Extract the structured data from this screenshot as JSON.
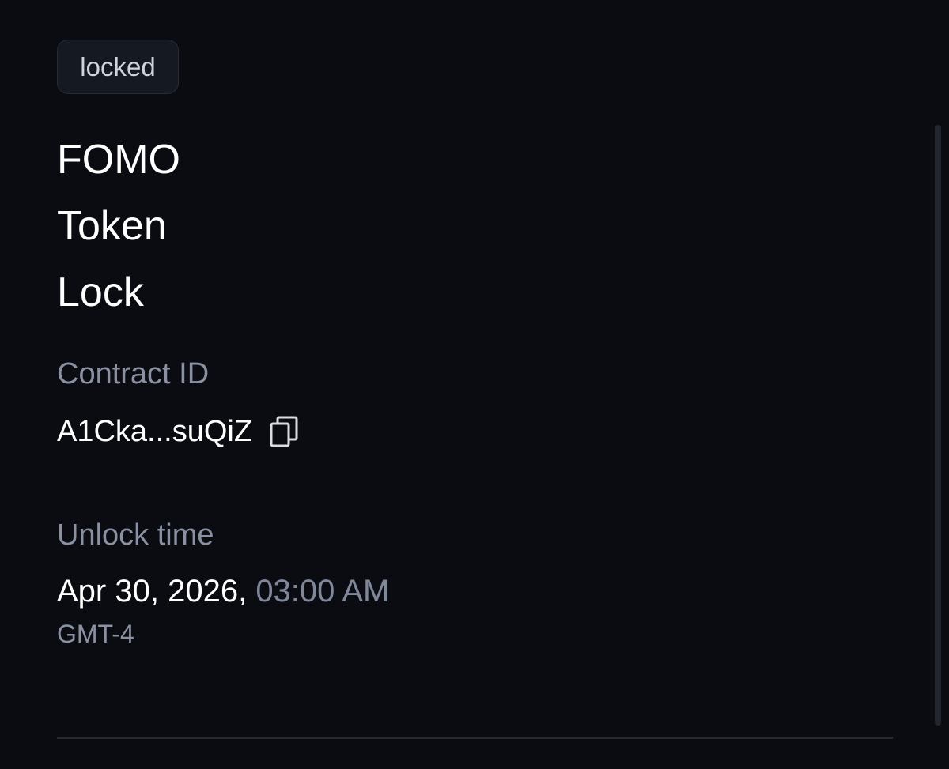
{
  "status_badge": "locked",
  "title_lines": [
    "FOMO",
    "Token",
    "Lock"
  ],
  "contract": {
    "label": "Contract ID",
    "value": "A1Cka...suQiZ",
    "copy_icon": "copy-icon"
  },
  "unlock": {
    "label": "Unlock time",
    "date": "Apr 30, 2026,",
    "time": "03:00 AM",
    "timezone": "GMT-4"
  },
  "colors": {
    "background": "#0b0c11",
    "primary_text": "#ffffff",
    "secondary_text": "#8a91a3",
    "badge_bg": "#151922"
  }
}
